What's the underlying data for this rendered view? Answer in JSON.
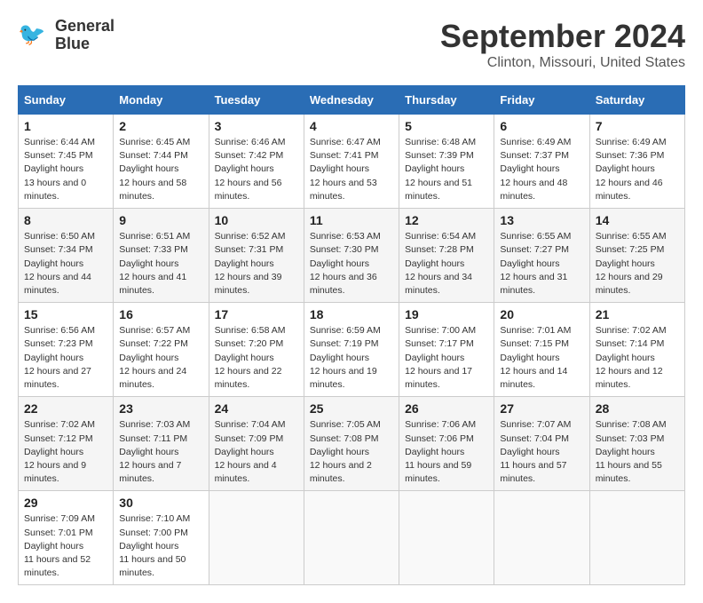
{
  "header": {
    "logo_line1": "General",
    "logo_line2": "Blue",
    "title": "September 2024",
    "subtitle": "Clinton, Missouri, United States"
  },
  "days_of_week": [
    "Sunday",
    "Monday",
    "Tuesday",
    "Wednesday",
    "Thursday",
    "Friday",
    "Saturday"
  ],
  "weeks": [
    [
      {
        "num": "1",
        "sunrise": "6:44 AM",
        "sunset": "7:45 PM",
        "daylight": "13 hours and 0 minutes."
      },
      {
        "num": "2",
        "sunrise": "6:45 AM",
        "sunset": "7:44 PM",
        "daylight": "12 hours and 58 minutes."
      },
      {
        "num": "3",
        "sunrise": "6:46 AM",
        "sunset": "7:42 PM",
        "daylight": "12 hours and 56 minutes."
      },
      {
        "num": "4",
        "sunrise": "6:47 AM",
        "sunset": "7:41 PM",
        "daylight": "12 hours and 53 minutes."
      },
      {
        "num": "5",
        "sunrise": "6:48 AM",
        "sunset": "7:39 PM",
        "daylight": "12 hours and 51 minutes."
      },
      {
        "num": "6",
        "sunrise": "6:49 AM",
        "sunset": "7:37 PM",
        "daylight": "12 hours and 48 minutes."
      },
      {
        "num": "7",
        "sunrise": "6:49 AM",
        "sunset": "7:36 PM",
        "daylight": "12 hours and 46 minutes."
      }
    ],
    [
      {
        "num": "8",
        "sunrise": "6:50 AM",
        "sunset": "7:34 PM",
        "daylight": "12 hours and 44 minutes."
      },
      {
        "num": "9",
        "sunrise": "6:51 AM",
        "sunset": "7:33 PM",
        "daylight": "12 hours and 41 minutes."
      },
      {
        "num": "10",
        "sunrise": "6:52 AM",
        "sunset": "7:31 PM",
        "daylight": "12 hours and 39 minutes."
      },
      {
        "num": "11",
        "sunrise": "6:53 AM",
        "sunset": "7:30 PM",
        "daylight": "12 hours and 36 minutes."
      },
      {
        "num": "12",
        "sunrise": "6:54 AM",
        "sunset": "7:28 PM",
        "daylight": "12 hours and 34 minutes."
      },
      {
        "num": "13",
        "sunrise": "6:55 AM",
        "sunset": "7:27 PM",
        "daylight": "12 hours and 31 minutes."
      },
      {
        "num": "14",
        "sunrise": "6:55 AM",
        "sunset": "7:25 PM",
        "daylight": "12 hours and 29 minutes."
      }
    ],
    [
      {
        "num": "15",
        "sunrise": "6:56 AM",
        "sunset": "7:23 PM",
        "daylight": "12 hours and 27 minutes."
      },
      {
        "num": "16",
        "sunrise": "6:57 AM",
        "sunset": "7:22 PM",
        "daylight": "12 hours and 24 minutes."
      },
      {
        "num": "17",
        "sunrise": "6:58 AM",
        "sunset": "7:20 PM",
        "daylight": "12 hours and 22 minutes."
      },
      {
        "num": "18",
        "sunrise": "6:59 AM",
        "sunset": "7:19 PM",
        "daylight": "12 hours and 19 minutes."
      },
      {
        "num": "19",
        "sunrise": "7:00 AM",
        "sunset": "7:17 PM",
        "daylight": "12 hours and 17 minutes."
      },
      {
        "num": "20",
        "sunrise": "7:01 AM",
        "sunset": "7:15 PM",
        "daylight": "12 hours and 14 minutes."
      },
      {
        "num": "21",
        "sunrise": "7:02 AM",
        "sunset": "7:14 PM",
        "daylight": "12 hours and 12 minutes."
      }
    ],
    [
      {
        "num": "22",
        "sunrise": "7:02 AM",
        "sunset": "7:12 PM",
        "daylight": "12 hours and 9 minutes."
      },
      {
        "num": "23",
        "sunrise": "7:03 AM",
        "sunset": "7:11 PM",
        "daylight": "12 hours and 7 minutes."
      },
      {
        "num": "24",
        "sunrise": "7:04 AM",
        "sunset": "7:09 PM",
        "daylight": "12 hours and 4 minutes."
      },
      {
        "num": "25",
        "sunrise": "7:05 AM",
        "sunset": "7:08 PM",
        "daylight": "12 hours and 2 minutes."
      },
      {
        "num": "26",
        "sunrise": "7:06 AM",
        "sunset": "7:06 PM",
        "daylight": "11 hours and 59 minutes."
      },
      {
        "num": "27",
        "sunrise": "7:07 AM",
        "sunset": "7:04 PM",
        "daylight": "11 hours and 57 minutes."
      },
      {
        "num": "28",
        "sunrise": "7:08 AM",
        "sunset": "7:03 PM",
        "daylight": "11 hours and 55 minutes."
      }
    ],
    [
      {
        "num": "29",
        "sunrise": "7:09 AM",
        "sunset": "7:01 PM",
        "daylight": "11 hours and 52 minutes."
      },
      {
        "num": "30",
        "sunrise": "7:10 AM",
        "sunset": "7:00 PM",
        "daylight": "11 hours and 50 minutes."
      },
      null,
      null,
      null,
      null,
      null
    ]
  ]
}
